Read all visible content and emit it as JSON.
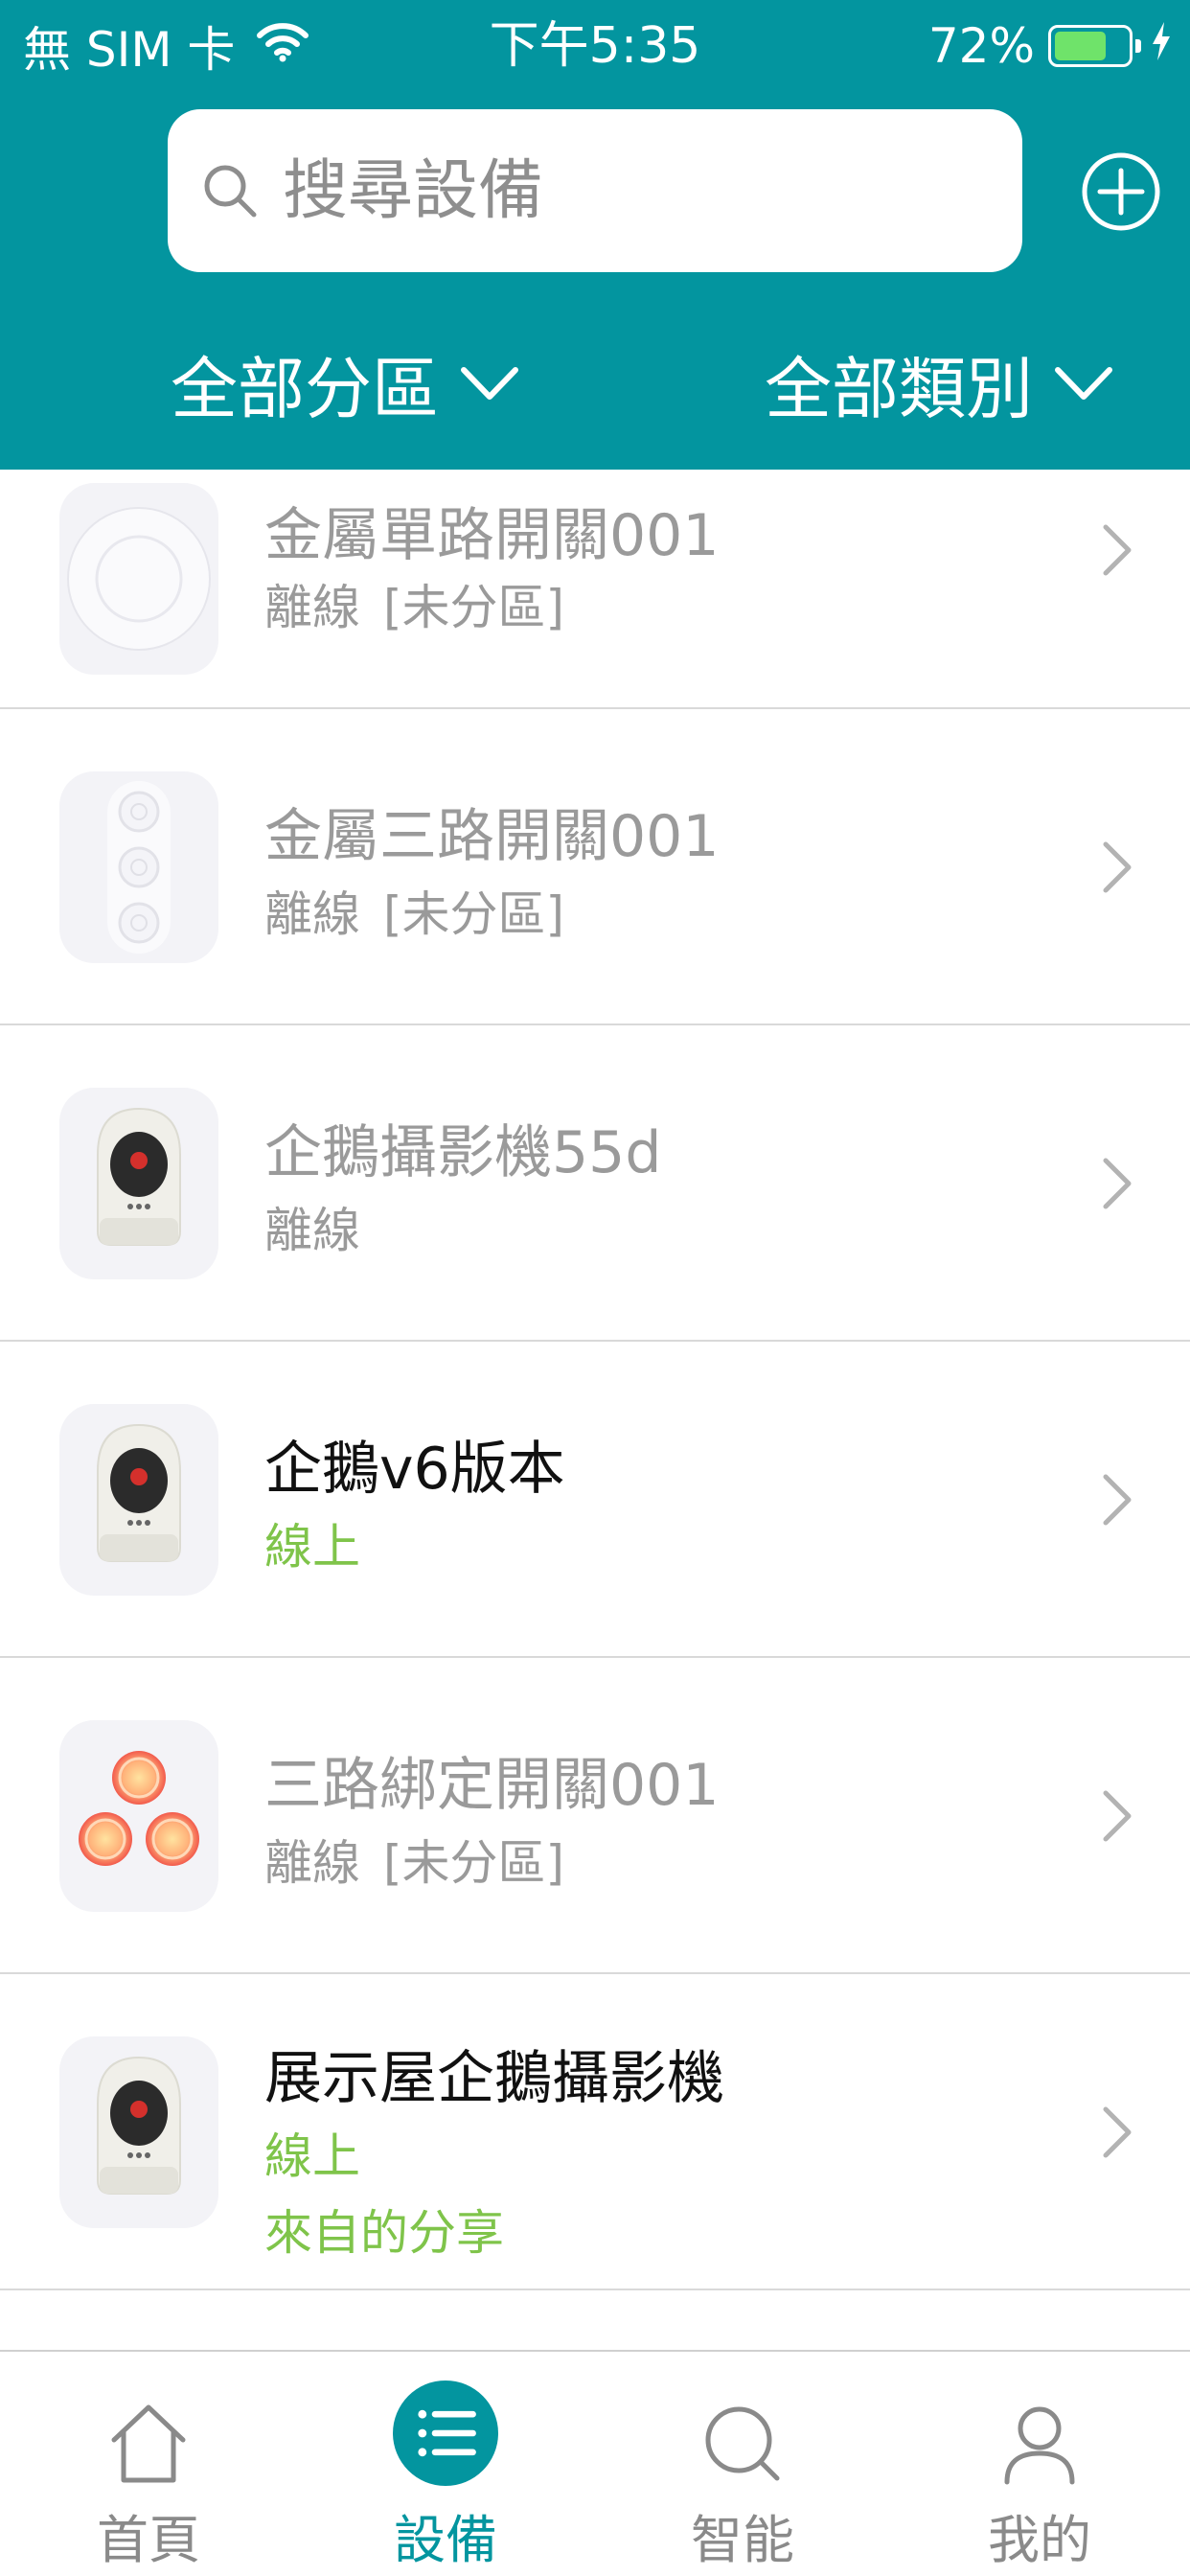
{
  "status_bar": {
    "carrier": "無 SIM 卡",
    "time": "下午5:35",
    "battery_percent": "72%",
    "battery_level": 0.72
  },
  "header": {
    "search_placeholder": "搜尋設備",
    "filter_zone": "全部分區",
    "filter_type": "全部類別"
  },
  "devices": [
    {
      "name": "金屬單路開關001",
      "status": "離線",
      "zone": "[未分區]",
      "online": false,
      "icon": "single-switch-icon"
    },
    {
      "name": "金屬三路開關001",
      "status": "離線",
      "zone": "[未分區]",
      "online": false,
      "icon": "triple-switch-icon"
    },
    {
      "name": "企鵝攝影機55d",
      "status": "離線",
      "zone": "",
      "online": false,
      "icon": "camera-icon"
    },
    {
      "name": "企鵝v6版本",
      "status": "線上",
      "zone": "",
      "online": true,
      "icon": "camera-icon"
    },
    {
      "name": "三路綁定開關001",
      "status": "離線",
      "zone": "[未分區]",
      "online": false,
      "icon": "binding-switch-icon"
    },
    {
      "name": "展示屋企鵝攝影機",
      "status": "線上",
      "zone": "",
      "share": "來自的分享",
      "online": true,
      "icon": "camera-icon"
    }
  ],
  "tabs": [
    {
      "label": "首頁",
      "icon": "home-icon",
      "active": false
    },
    {
      "label": "設備",
      "icon": "device-list-icon",
      "active": true
    },
    {
      "label": "智能",
      "icon": "smart-search-icon",
      "active": false
    },
    {
      "label": "我的",
      "icon": "profile-icon",
      "active": false
    }
  ],
  "colors": {
    "header_teal": "#03959f",
    "online_green": "#7fc44a",
    "offline_gray": "#9a9a9a"
  }
}
